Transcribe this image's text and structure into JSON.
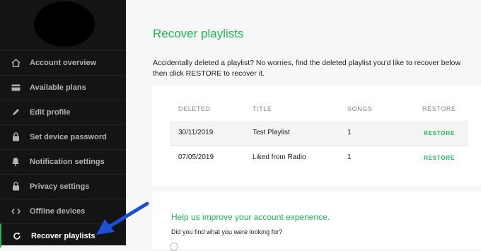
{
  "sidebar": {
    "items": [
      {
        "label": "Account overview",
        "icon": "home-icon"
      },
      {
        "label": "Available plans",
        "icon": "card-icon"
      },
      {
        "label": "Edit profile",
        "icon": "pencil-icon"
      },
      {
        "label": "Set device password",
        "icon": "lock-icon"
      },
      {
        "label": "Notification settings",
        "icon": "bell-icon"
      },
      {
        "label": "Privacy settings",
        "icon": "lock-icon"
      },
      {
        "label": "Offline devices",
        "icon": "code-icon"
      },
      {
        "label": "Recover playlists",
        "icon": "refresh-icon",
        "active": true
      }
    ]
  },
  "main": {
    "title": "Recover playlists",
    "intro": "Accidentally deleted a playlist? No worries, find the deleted playlist you'd like to recover below  then click RESTORE to recover it.",
    "table": {
      "headers": {
        "deleted": "DELETED",
        "title": "TITLE",
        "songs": "SONGS",
        "restore": "RESTORE"
      },
      "rows": [
        {
          "deleted": "30/11/2019",
          "title": "Test Playlist",
          "songs": "1",
          "action": "RESTORE"
        },
        {
          "deleted": "07/05/2019",
          "title": "Liked from Radio",
          "songs": "1",
          "action": "RESTORE"
        }
      ]
    },
    "feedback": {
      "title": "Help us improve your account experience.",
      "question": "Did you find what you were looking for?"
    }
  },
  "colors": {
    "accent": "#1db954",
    "sidebar_bg": "#141414",
    "annotation_arrow": "#1a4fd6"
  }
}
